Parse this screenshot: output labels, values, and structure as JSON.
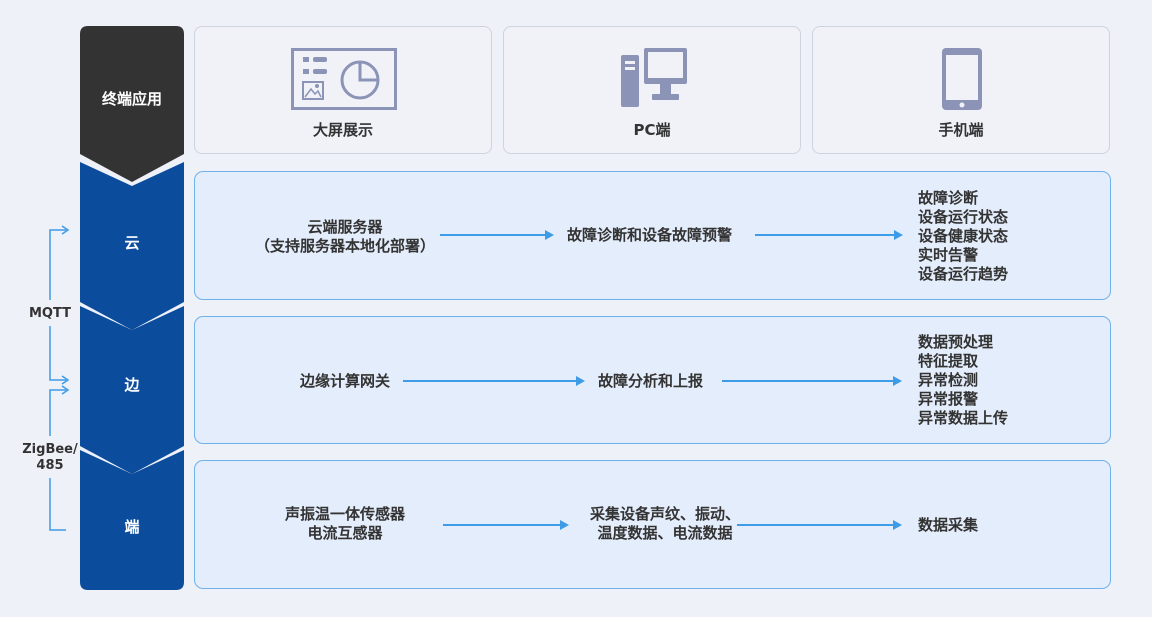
{
  "layers": {
    "terminal": "终端应用",
    "cloud": "云",
    "edge": "边",
    "device": "端"
  },
  "protocols": {
    "mqtt": "MQTT",
    "zigbee_1": "ZigBee/",
    "zigbee_2": "485"
  },
  "apps": [
    {
      "label": "大屏展示",
      "icon": "dashboard-icon"
    },
    {
      "label": "PC端",
      "icon": "desktop-computer-icon"
    },
    {
      "label": "手机端",
      "icon": "mobile-phone-icon"
    }
  ],
  "cloud_row": {
    "source_1": "云端服务器",
    "source_2": "（支持服务器本地化部署）",
    "process": "故障诊断和设备故障预警",
    "outputs": [
      "故障诊断",
      "设备运行状态",
      "设备健康状态",
      "实时告警",
      "设备运行趋势"
    ]
  },
  "edge_row": {
    "source": "边缘计算网关",
    "process": "故障分析和上报",
    "outputs": [
      "数据预处理",
      "特征提取",
      "异常检测",
      "异常报警",
      "异常数据上传"
    ]
  },
  "device_row": {
    "source_1": "声振温一体传感器",
    "source_2": "电流互感器",
    "process_1": "采集设备声纹、振动、",
    "process_2": "温度数据、电流数据",
    "output": "数据采集"
  },
  "colors": {
    "terminal_chevron": "#333333",
    "layer_chevron": "#0c4c9c",
    "panel_bg": "#e4edfb",
    "panel_border": "#6fb1ea",
    "arrow": "#3e9be6",
    "icon": "#8b93b6"
  }
}
